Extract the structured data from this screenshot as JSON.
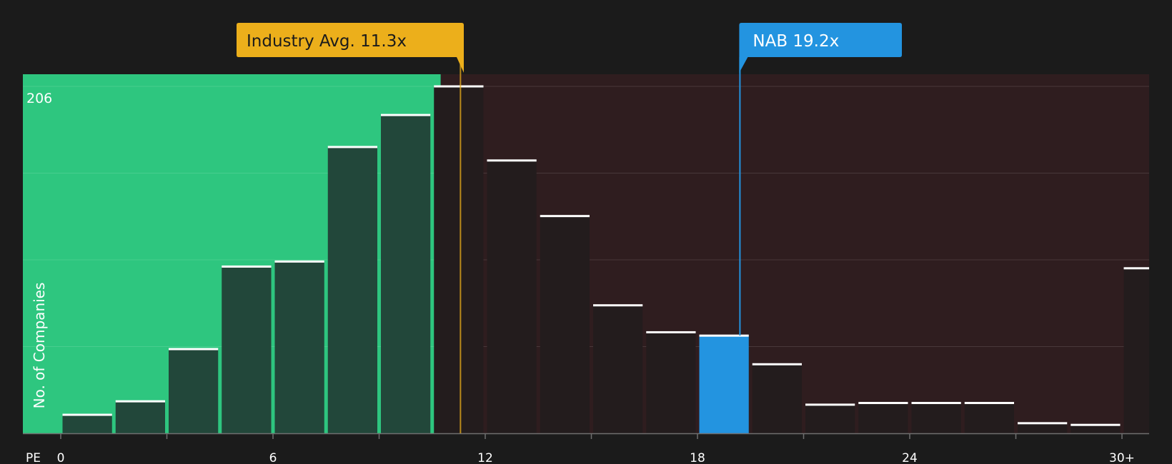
{
  "chart_data": {
    "type": "bar",
    "x_axis_label": "PE",
    "y_axis_label": "No. of Companies",
    "y_max_label": "206",
    "ylim": [
      0,
      206
    ],
    "x_ticks": [
      "0",
      "6",
      "12",
      "18",
      "24",
      "30+"
    ],
    "bins": [
      {
        "start": 0,
        "end": 1.5,
        "count": 11
      },
      {
        "start": 1.5,
        "end": 3,
        "count": 19
      },
      {
        "start": 3,
        "end": 4.5,
        "count": 50
      },
      {
        "start": 4.5,
        "end": 6,
        "count": 99
      },
      {
        "start": 6,
        "end": 7.5,
        "count": 102
      },
      {
        "start": 7.5,
        "end": 9,
        "count": 170
      },
      {
        "start": 9,
        "end": 10.5,
        "count": 189
      },
      {
        "start": 10.5,
        "end": 12,
        "count": 206
      },
      {
        "start": 12,
        "end": 13.5,
        "count": 162
      },
      {
        "start": 13.5,
        "end": 15,
        "count": 129
      },
      {
        "start": 15,
        "end": 16.5,
        "count": 76
      },
      {
        "start": 16.5,
        "end": 18,
        "count": 60
      },
      {
        "start": 18,
        "end": 19.5,
        "count": 58
      },
      {
        "start": 19.5,
        "end": 21,
        "count": 41
      },
      {
        "start": 21,
        "end": 22.5,
        "count": 17
      },
      {
        "start": 22.5,
        "end": 24,
        "count": 18
      },
      {
        "start": 24,
        "end": 25.5,
        "count": 18
      },
      {
        "start": 25.5,
        "end": 27,
        "count": 18
      },
      {
        "start": 27,
        "end": 28.5,
        "count": 6
      },
      {
        "start": 28.5,
        "end": 30,
        "count": 5
      },
      {
        "start": 30,
        "end": 31.5,
        "count": 98
      }
    ],
    "industry_avg": {
      "label": "Industry Avg. 11.3x",
      "value": 11.3
    },
    "company": {
      "label": "NAB 19.2x",
      "value": 19.2,
      "bin_index": 12
    },
    "colors": {
      "background": "#1b1b1b",
      "below_zone": "#2ec67f",
      "above_zone": "#2f1d1f",
      "bar_in_green": "#22473a",
      "bar_in_red": "#231c1d",
      "highlight": "#2394e0",
      "industry": "#ecaf1b",
      "bar_cap": "#ffffff"
    }
  }
}
